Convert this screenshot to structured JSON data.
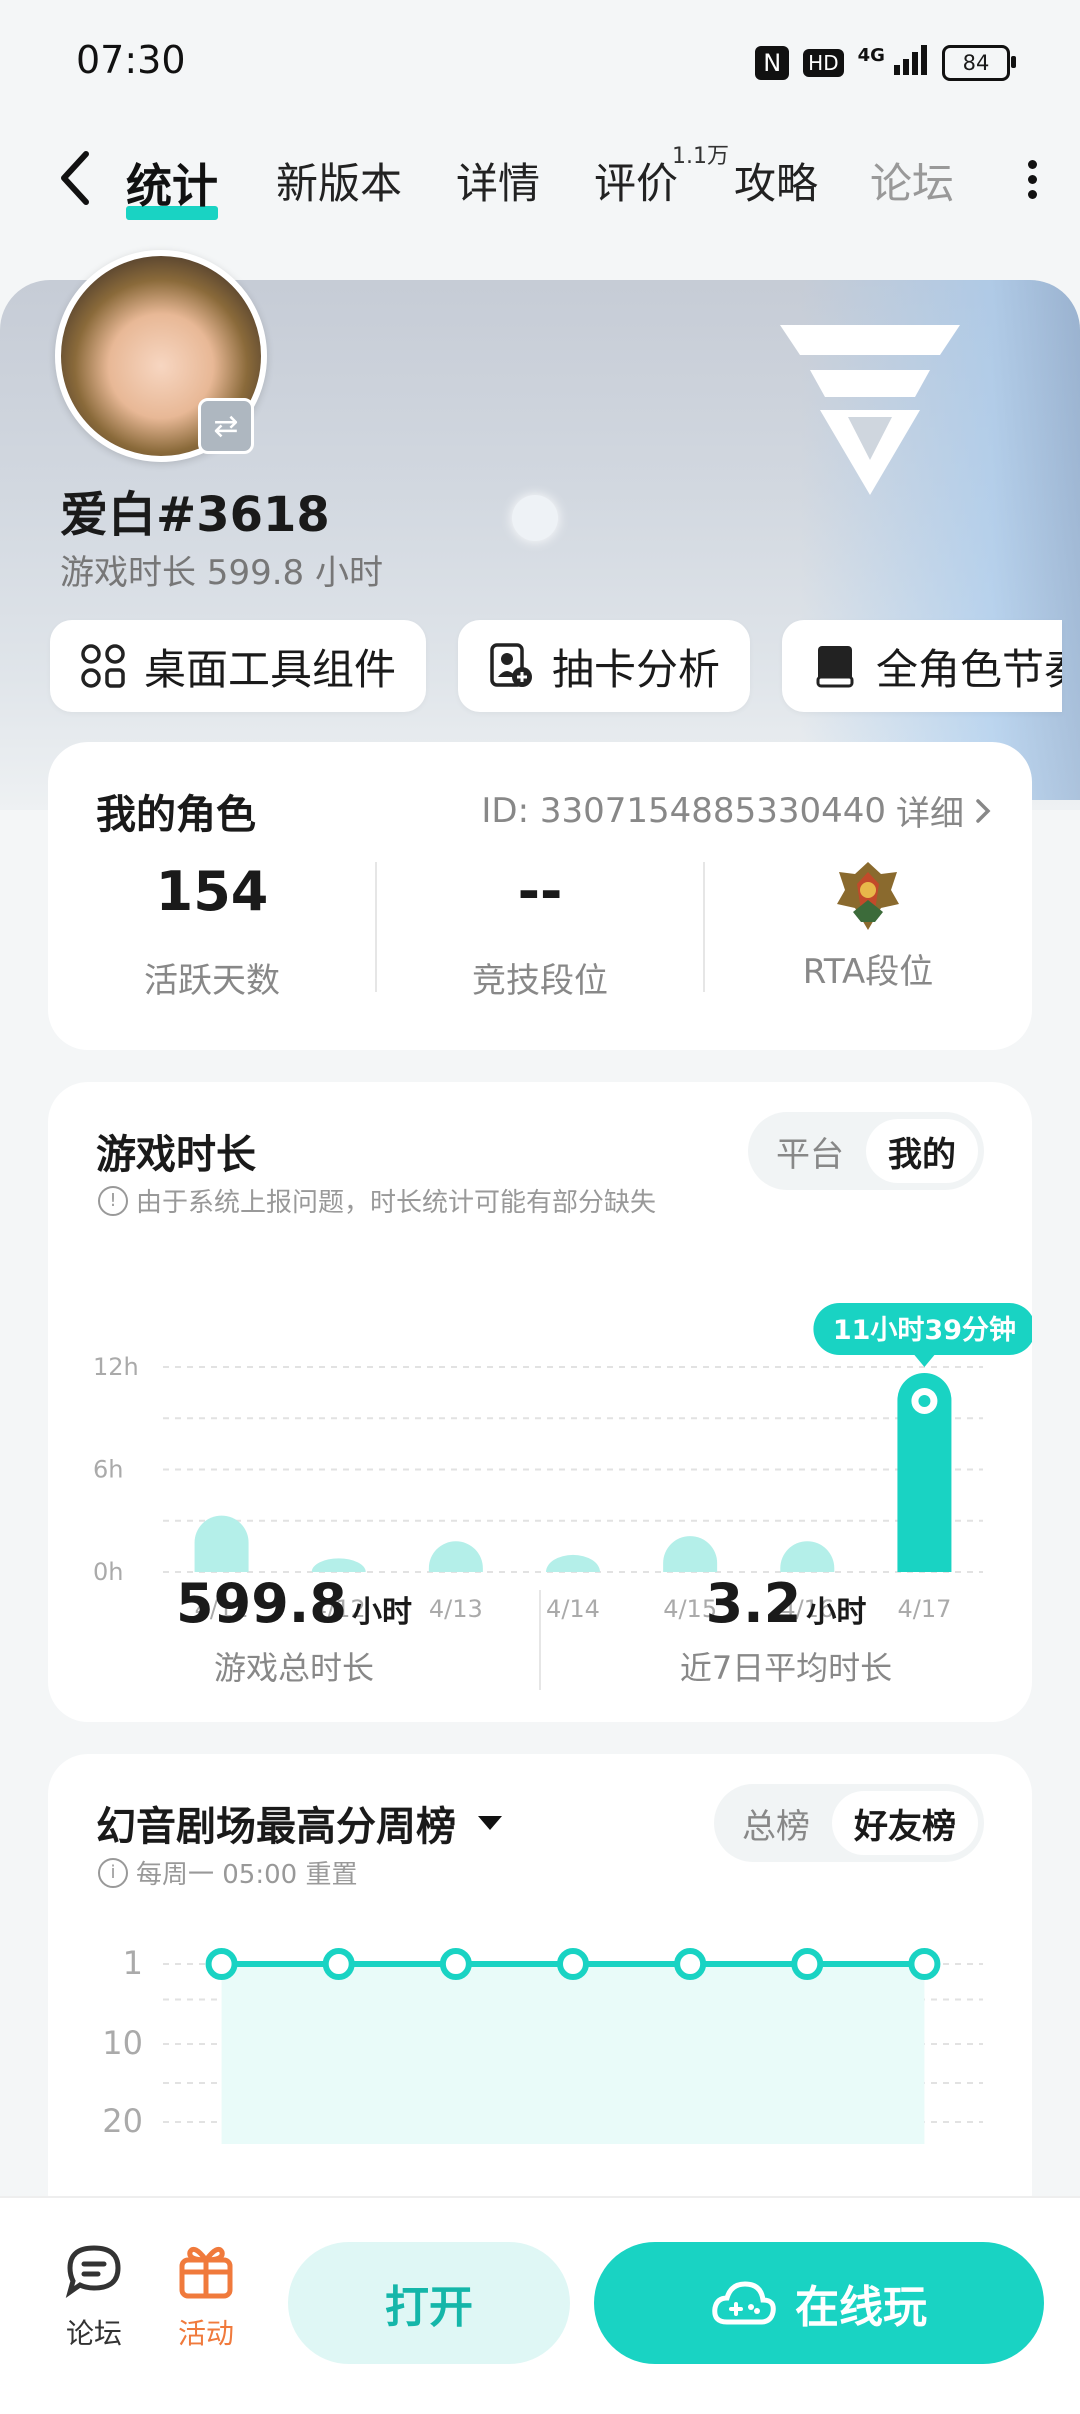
{
  "status_bar": {
    "time": "07:30",
    "nfc": "N",
    "hd": "HD",
    "net": "4G",
    "battery": "84"
  },
  "nav": {
    "tabs": [
      {
        "label": "统计",
        "active": true
      },
      {
        "label": "新版本"
      },
      {
        "label": "详情"
      },
      {
        "label": "评价",
        "badge": "1.1万"
      },
      {
        "label": "攻略"
      },
      {
        "label": "论坛"
      }
    ]
  },
  "profile": {
    "name": "爱白#3618",
    "playtime": "游戏时长 599.8 小时"
  },
  "chips": [
    {
      "label": "桌面工具组件",
      "icon": "widgets-icon"
    },
    {
      "label": "抽卡分析",
      "icon": "card-analysis-icon"
    },
    {
      "label": "全角色节奏",
      "icon": "book-icon"
    }
  ],
  "my_role": {
    "title": "我的角色",
    "id_text": "ID: 3307154885330440",
    "detail": "详细",
    "stats": [
      {
        "value": "154",
        "label": "活跃天数"
      },
      {
        "value": "--",
        "label": "竞技段位"
      },
      {
        "value": "",
        "label": "RTA段位",
        "icon": "rank-emblem-icon"
      }
    ]
  },
  "playtime": {
    "title": "游戏时长",
    "note": "由于系统上报问题，时长统计可能有部分缺失",
    "toggle": [
      "平台",
      "我的"
    ],
    "toggle_selected": "我的",
    "tooltip": "11小时39分钟",
    "summary": [
      {
        "value": "599.8",
        "unit": "小时",
        "label": "游戏总时长"
      },
      {
        "value": "3.2",
        "unit": "小时",
        "label": "近7日平均时长"
      }
    ]
  },
  "chart_data": {
    "type": "bar",
    "categories": [
      "4/11",
      "4/12",
      "4/13",
      "4/14",
      "4/15",
      "4/16",
      "4/17"
    ],
    "values": [
      3.3,
      0.8,
      1.8,
      1.0,
      2.1,
      1.8,
      11.65
    ],
    "ylim": [
      0,
      12
    ],
    "yticks": [
      "12h",
      "6h",
      "0h"
    ],
    "highlight_index": 6,
    "colors": {
      "normal": "#b4efe9",
      "highlight": "#19d3c3"
    },
    "grid": true
  },
  "leaderboard": {
    "title": "幻音剧场最高分周榜",
    "note": "每周一 05:00 重置",
    "toggle": [
      "总榜",
      "好友榜"
    ],
    "toggle_selected": "好友榜",
    "yticks": [
      "1",
      "10",
      "20"
    ],
    "points": [
      1,
      1,
      1,
      1,
      1,
      1,
      1
    ],
    "color": "#19d3c3"
  },
  "bottom_bar": {
    "forum": "论坛",
    "activity": "活动",
    "open": "打开",
    "play": "在线玩"
  },
  "colors": {
    "accent": "#19d3c3",
    "activity": "#f07a3c"
  }
}
